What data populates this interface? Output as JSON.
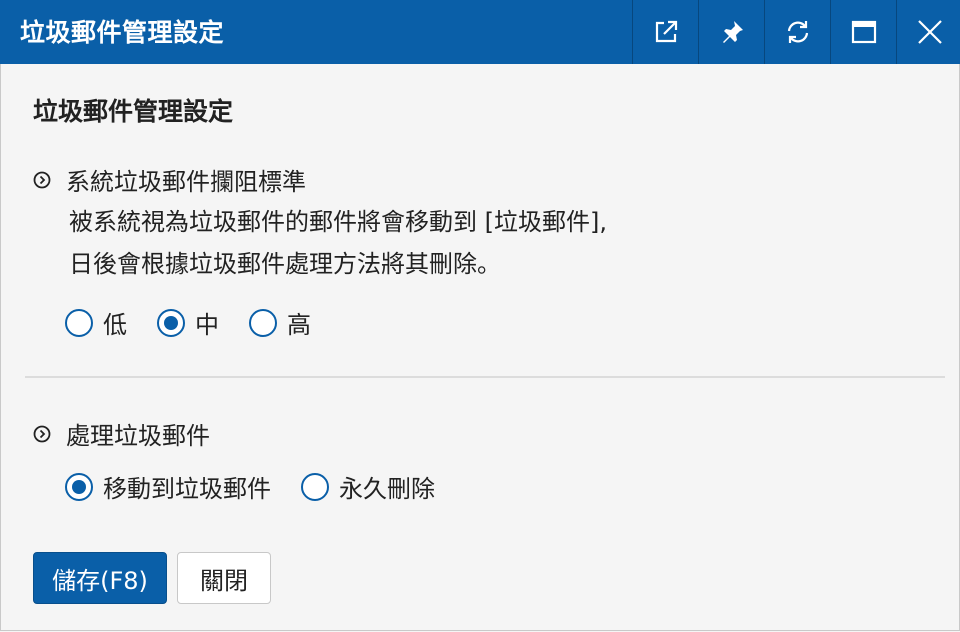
{
  "window": {
    "title": "垃圾郵件管理設定",
    "controls": [
      "popout-icon",
      "pin-icon",
      "refresh-icon",
      "maximize-icon",
      "close-icon"
    ]
  },
  "page": {
    "heading": "垃圾郵件管理設定"
  },
  "filter_section": {
    "title": "系統垃圾郵件攔阻標準",
    "desc_line1": "被系統視為垃圾郵件的郵件將會移動到 [垃圾郵件],",
    "desc_line2": "日後會根據垃圾郵件處理方法將其刪除。",
    "options": [
      "低",
      "中",
      "高"
    ],
    "selected": "中"
  },
  "handling_section": {
    "title": "處理垃圾郵件",
    "options": [
      "移動到垃圾郵件",
      "永久刪除"
    ],
    "selected": "移動到垃圾郵件"
  },
  "buttons": {
    "save": "儲存(F8)",
    "close": "關閉"
  },
  "colors": {
    "accent": "#0a5fa8",
    "background": "#f5f5f5"
  }
}
